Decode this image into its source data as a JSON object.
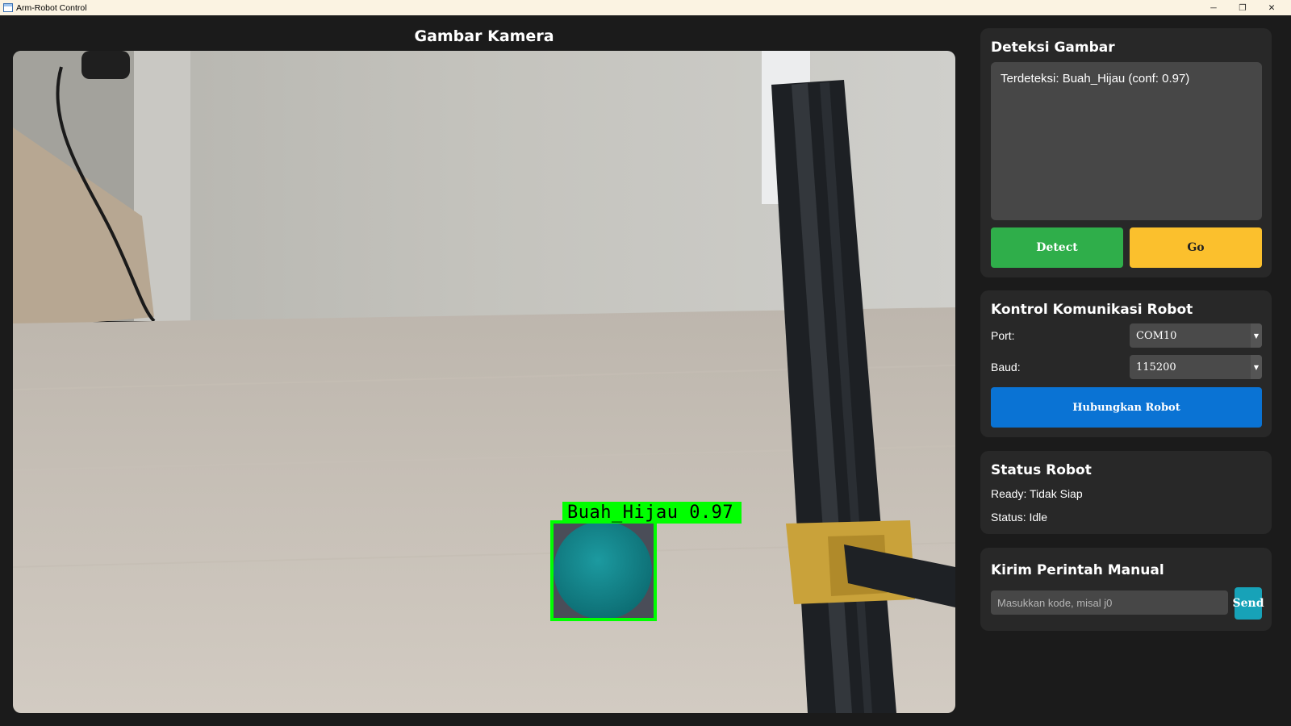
{
  "window": {
    "title": "Arm-Robot Control",
    "controls": {
      "minimize": "─",
      "maximize": "❐",
      "close": "✕"
    }
  },
  "camera": {
    "title": "Gambar Kamera",
    "detection_label": "Buah_Hijau 0.97"
  },
  "detect_panel": {
    "title": "Deteksi Gambar",
    "result_text": "Terdeteksi: Buah_Hijau (conf: 0.97)",
    "detect_label": "Detect",
    "go_label": "Go"
  },
  "comm_panel": {
    "title": "Kontrol Komunikasi Robot",
    "port_label": "Port:",
    "port_value": "COM10",
    "baud_label": "Baud:",
    "baud_value": "115200",
    "connect_label": "Hubungkan Robot"
  },
  "status_panel": {
    "title": "Status Robot",
    "ready_text": "Ready: Tidak Siap",
    "status_text": "Status: Idle"
  },
  "manual_panel": {
    "title": "Kirim Perintah Manual",
    "input_placeholder": "Masukkan kode, misal j0",
    "input_value": "",
    "send_label": "Send"
  },
  "colors": {
    "background": "#1b1b1b",
    "panel": "#282828",
    "detect_button": "#2fae4a",
    "go_button": "#fbc02d",
    "connect_button": "#0a73d4",
    "send_button": "#17a2b8",
    "detection_box": "#00ff00"
  },
  "icons": {
    "app": "app-window-icon",
    "dropdown": "chevron-down-icon"
  }
}
